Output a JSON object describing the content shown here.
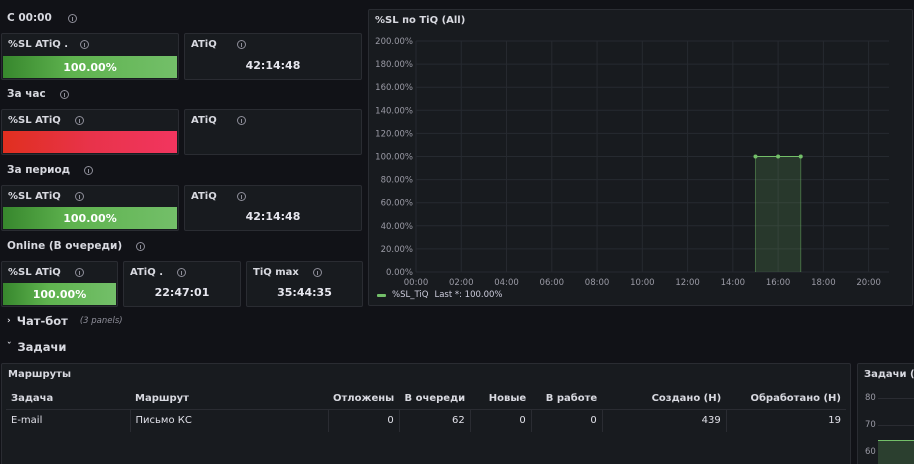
{
  "sections": {
    "s1": "С 00:00",
    "s2": "За час",
    "s3": "За период",
    "s4": "Online (В очереди)"
  },
  "stats": {
    "s1_sl_title": "%SL ATiQ .",
    "s1_sl_value": "100.00%",
    "s1_atiq_title": "ATiQ",
    "s1_atiq_value": "42:14:48",
    "s2_sl_title": "%SL ATiQ",
    "s2_atiq_title": "ATiQ",
    "s3_sl_title": "%SL ATiQ",
    "s3_sl_value": "100.00%",
    "s3_atiq_title": "ATiQ",
    "s3_atiq_value": "42:14:48",
    "s4_sl_title": "%SL ATiQ",
    "s4_sl_value": "100.00%",
    "s4_atiq_title": "ATiQ .",
    "s4_atiq_value": "22:47:01",
    "s4_max_title": "TiQ max",
    "s4_max_value": "35:44:35"
  },
  "chart_panel": {
    "title": "%SL по TiQ (All)",
    "legend_text": "%SL_TiQ",
    "legend_last": "Last *: 100.00%",
    "legend_color": "#73bf69"
  },
  "chart_data": {
    "type": "area",
    "series": [
      {
        "name": "%SL_TiQ",
        "x": [
          "15:00",
          "16:00",
          "17:00"
        ],
        "values": [
          100,
          100,
          100
        ]
      }
    ],
    "x_ticks": [
      "00:00",
      "02:00",
      "04:00",
      "06:00",
      "08:00",
      "10:00",
      "12:00",
      "14:00",
      "16:00",
      "18:00",
      "20:00"
    ],
    "y_ticks": [
      "0.00%",
      "20.00%",
      "40.00%",
      "60.00%",
      "80.00%",
      "100.00%",
      "120.00%",
      "140.00%",
      "160.00%",
      "180.00%",
      "200.00%"
    ],
    "ylim": [
      0,
      200
    ],
    "xlim_hours": [
      0,
      20.9
    ],
    "grid": true
  },
  "rows": {
    "chatbot_label": "Чат-бот",
    "chatbot_count": "(3 panels)",
    "tasks_label": "Задачи"
  },
  "routes_panel": {
    "title": "Маршруты",
    "headers": [
      "Задача",
      "Маршрут",
      "Отложены",
      "В очереди",
      "Новые",
      "В работе",
      "Создано (Н)",
      "Обработано (Н)"
    ],
    "rows": [
      [
        "E-mail",
        "Письмо КС",
        "0",
        "62",
        "0",
        "0",
        "439",
        "19"
      ]
    ]
  },
  "right_panel": {
    "title": "Задачи (All",
    "y_ticks": [
      "80",
      "70",
      "60"
    ]
  }
}
